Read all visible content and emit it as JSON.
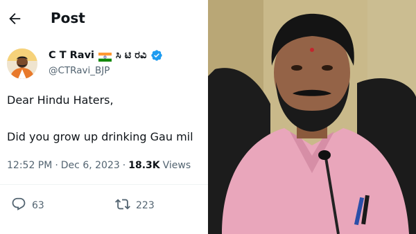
{
  "header": {
    "title": "Post",
    "back_icon": "arrow-left-icon"
  },
  "author": {
    "name": "C T Ravi",
    "flag_icon": "india-flag-icon",
    "native_name": "ಸಿ ಟಿ ರವಿ",
    "verified_icon": "verified-badge-icon",
    "handle": "@CTRavi_BJP"
  },
  "tweet": {
    "line1": "Dear Hindu Haters,",
    "line2": "Did you grow up drinking Gau mil"
  },
  "meta": {
    "time": "12:52 PM",
    "sep1": "·",
    "date": "Dec 6, 2023",
    "sep2": "·",
    "views_count": "18.3K",
    "views_label": "Views"
  },
  "actions": {
    "replies": "63",
    "reposts": "223"
  },
  "colors": {
    "text": "#0f1419",
    "secondary": "#536471",
    "verified": "#1d9bf0",
    "divider": "#eff3f4"
  }
}
